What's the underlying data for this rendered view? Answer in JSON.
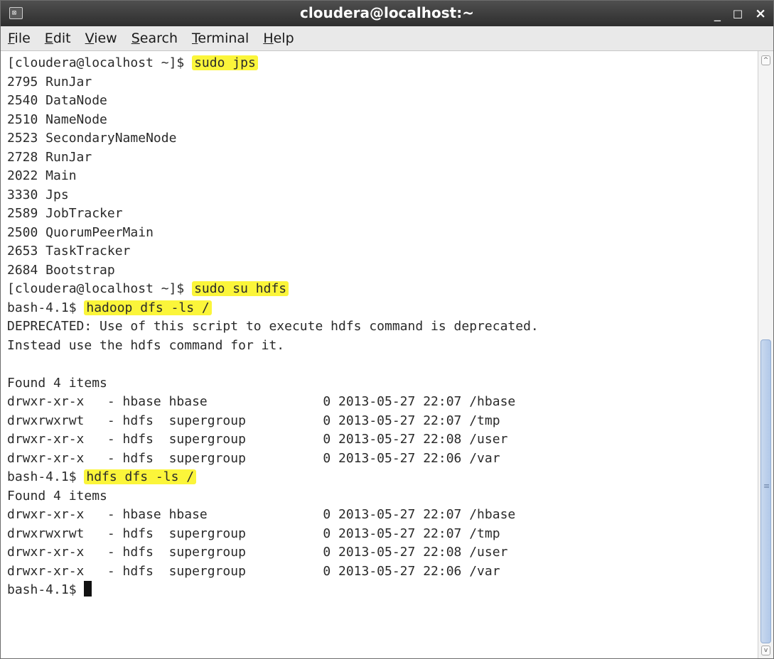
{
  "window": {
    "title": "cloudera@localhost:~",
    "icon": "terminal-icon",
    "icon_glyph": "⊠",
    "controls": {
      "minimize": "_",
      "maximize": "□",
      "close": "×"
    }
  },
  "menu": {
    "items": [
      {
        "mnemonic": "F",
        "rest": "ile"
      },
      {
        "mnemonic": "E",
        "rest": "dit"
      },
      {
        "mnemonic": "V",
        "rest": "iew"
      },
      {
        "mnemonic": "S",
        "rest": "earch"
      },
      {
        "mnemonic": "T",
        "rest": "erminal"
      },
      {
        "mnemonic": "H",
        "rest": "elp"
      }
    ]
  },
  "terminal": {
    "lines": [
      {
        "text": "[cloudera@localhost ~]$ ",
        "highlight": "sudo jps"
      },
      {
        "text": "2795 RunJar"
      },
      {
        "text": "2540 DataNode"
      },
      {
        "text": "2510 NameNode"
      },
      {
        "text": "2523 SecondaryNameNode"
      },
      {
        "text": "2728 RunJar"
      },
      {
        "text": "2022 Main"
      },
      {
        "text": "3330 Jps"
      },
      {
        "text": "2589 JobTracker"
      },
      {
        "text": "2500 QuorumPeerMain"
      },
      {
        "text": "2653 TaskTracker"
      },
      {
        "text": "2684 Bootstrap"
      },
      {
        "text": "[cloudera@localhost ~]$ ",
        "highlight": "sudo su hdfs"
      },
      {
        "text": "bash-4.1$ ",
        "highlight": "hadoop dfs -ls /"
      },
      {
        "text": "DEPRECATED: Use of this script to execute hdfs command is deprecated."
      },
      {
        "text": "Instead use the hdfs command for it."
      },
      {
        "text": ""
      },
      {
        "text": "Found 4 items"
      },
      {
        "text": "drwxr-xr-x   - hbase hbase               0 2013-05-27 22:07 /hbase"
      },
      {
        "text": "drwxrwxrwt   - hdfs  supergroup          0 2013-05-27 22:07 /tmp"
      },
      {
        "text": "drwxr-xr-x   - hdfs  supergroup          0 2013-05-27 22:08 /user"
      },
      {
        "text": "drwxr-xr-x   - hdfs  supergroup          0 2013-05-27 22:06 /var"
      },
      {
        "text": "bash-4.1$ ",
        "highlight": "hdfs dfs -ls /"
      },
      {
        "text": "Found 4 items"
      },
      {
        "text": "drwxr-xr-x   - hbase hbase               0 2013-05-27 22:07 /hbase"
      },
      {
        "text": "drwxrwxrwt   - hdfs  supergroup          0 2013-05-27 22:07 /tmp"
      },
      {
        "text": "drwxr-xr-x   - hdfs  supergroup          0 2013-05-27 22:08 /user"
      },
      {
        "text": "drwxr-xr-x   - hdfs  supergroup          0 2013-05-27 22:06 /var"
      },
      {
        "text": "bash-4.1$ ",
        "cursor": true
      }
    ]
  },
  "scrollbar": {
    "up_arrow": "^",
    "down_arrow": "v",
    "grip": "≡"
  },
  "colors": {
    "highlight": "#fbf53a",
    "titlebar": "#3a3a3a",
    "menubar": "#e9e9e9",
    "scroll_thumb": "#b9cde9"
  }
}
